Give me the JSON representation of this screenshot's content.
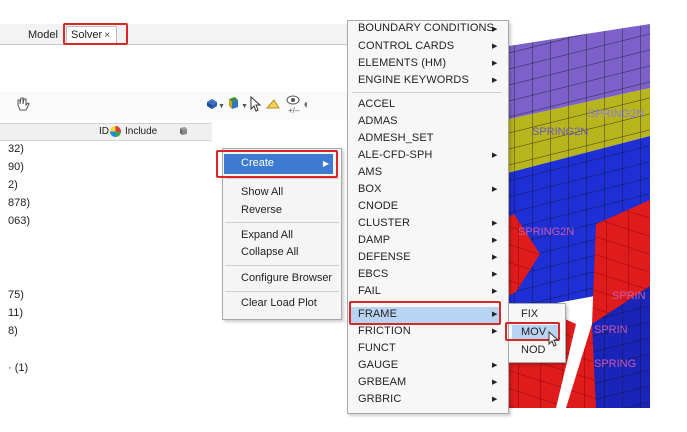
{
  "tabs": [
    {
      "label": "Model"
    },
    {
      "label": "Solver",
      "close": "×",
      "active": true
    }
  ],
  "browser": {
    "columns": {
      "id": "ID",
      "include": "Include"
    },
    "row_fragments": [
      "32)",
      "90)",
      "2)",
      "878)",
      "063)",
      "75)",
      "11)",
      "8)",
      "· (1)"
    ]
  },
  "context_menu": {
    "items": [
      "Create",
      "Show All",
      "Reverse",
      "Expand All",
      "Collapse All",
      "Configure Browser",
      "Clear Load Plot"
    ],
    "highlighted": "Create",
    "arrow": "▶"
  },
  "keyword_menu": {
    "top_items": [
      "BOUNDARY CONDITIONS",
      "CONTROL CARDS",
      "ELEMENTS (HM)",
      "ENGINE KEYWORDS"
    ],
    "items": [
      "ACCEL",
      "ADMAS",
      "ADMESH_SET",
      "ALE-CFD-SPH",
      "AMS",
      "BOX",
      "CNODE",
      "CLUSTER",
      "DAMP",
      "DEFENSE",
      "EBCS",
      "FAIL",
      "FRAME",
      "FRICTION",
      "FUNCT",
      "GAUGE",
      "GRBEAM",
      "GRBRIC"
    ],
    "highlighted": "FRAME",
    "arrow": "▶"
  },
  "frame_submenu": {
    "items": [
      "FIX",
      "MOV",
      "NOD"
    ],
    "highlighted": "MOV"
  },
  "viewport": {
    "labels": [
      "SPRING2N",
      "SPRING2N",
      "SPRING2N",
      "SPRIN",
      "SPRIN",
      "SPRING"
    ]
  },
  "icons": [
    "pan-icon",
    "display-mode-icon",
    "color-cube-icon",
    "pointer-icon",
    "find-icon",
    "visibility-toggle-icon",
    "multicolor-icon",
    "cube-icon",
    "mouse-cursor-icon"
  ],
  "colors": {
    "highlight_box": "#d62828",
    "menu_selected": "#3d7bd3",
    "submenu_hover": "#b9d4f2"
  }
}
